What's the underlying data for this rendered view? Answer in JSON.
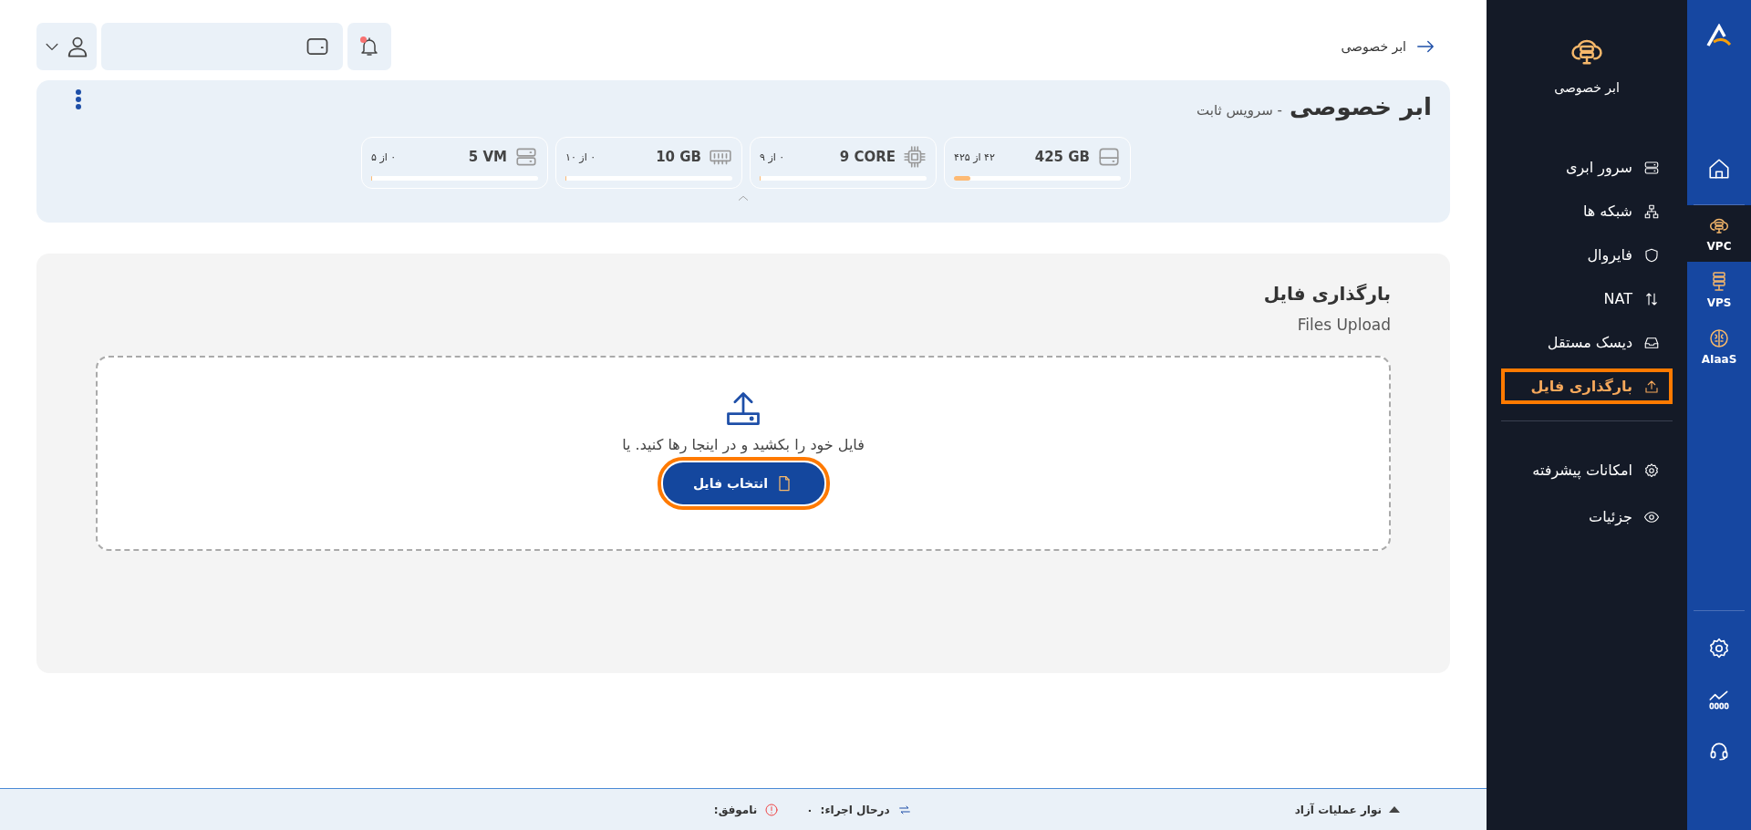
{
  "topbar": {
    "breadcrumb": "ابر خصوصی",
    "notifications": {
      "unread": true
    }
  },
  "header": {
    "title": "ابر خصوصی",
    "subtitle": "- سرویس ثابت",
    "resources": [
      {
        "value": "425 GB",
        "usage": "۴۲ از ۴۲۵",
        "level": 0.1
      },
      {
        "value": "9 CORE",
        "usage": "۰ از ۹",
        "level": 0
      },
      {
        "value": "10 GB",
        "usage": "۰ از ۱۰",
        "level": 0
      },
      {
        "value": "5 VM",
        "usage": "۰ از ۵",
        "level": 0
      }
    ]
  },
  "upload": {
    "title": "بارگذاری فایل",
    "subtitle": "Files Upload",
    "hint": "فایل خود را بکشید و در اینجا رها کنید. یا",
    "button": {
      "label": "انتخاب فایل",
      "highlighted": true
    }
  },
  "status_bar": {
    "toggle_label": "نوار عملیات آزاد",
    "running_label": "درحال اجراء:",
    "running_count": "۰",
    "failed_label": "ناموفق:"
  },
  "sidebar": {
    "service_label": "ابر خصوصی",
    "items": [
      {
        "label": "سرور ابری",
        "selected": false,
        "highlighted": false
      },
      {
        "label": "شبکه ها",
        "selected": false,
        "highlighted": false
      },
      {
        "label": "فایروال",
        "selected": false,
        "highlighted": false
      },
      {
        "label": "NAT",
        "selected": false,
        "highlighted": false
      },
      {
        "label": "دیسک مستقل",
        "selected": false,
        "highlighted": false
      },
      {
        "label": "بارگذاری فایل",
        "selected": true,
        "highlighted": true
      }
    ],
    "extra_items": [
      {
        "label": "امکانات پیشرفته",
        "selected": false
      },
      {
        "label": "جزئیات",
        "selected": false
      }
    ]
  },
  "rail": {
    "products": [
      {
        "label": "VPC",
        "selected": true
      },
      {
        "label": "VPS",
        "selected": false
      },
      {
        "label": "AIaaS",
        "selected": false
      }
    ]
  }
}
